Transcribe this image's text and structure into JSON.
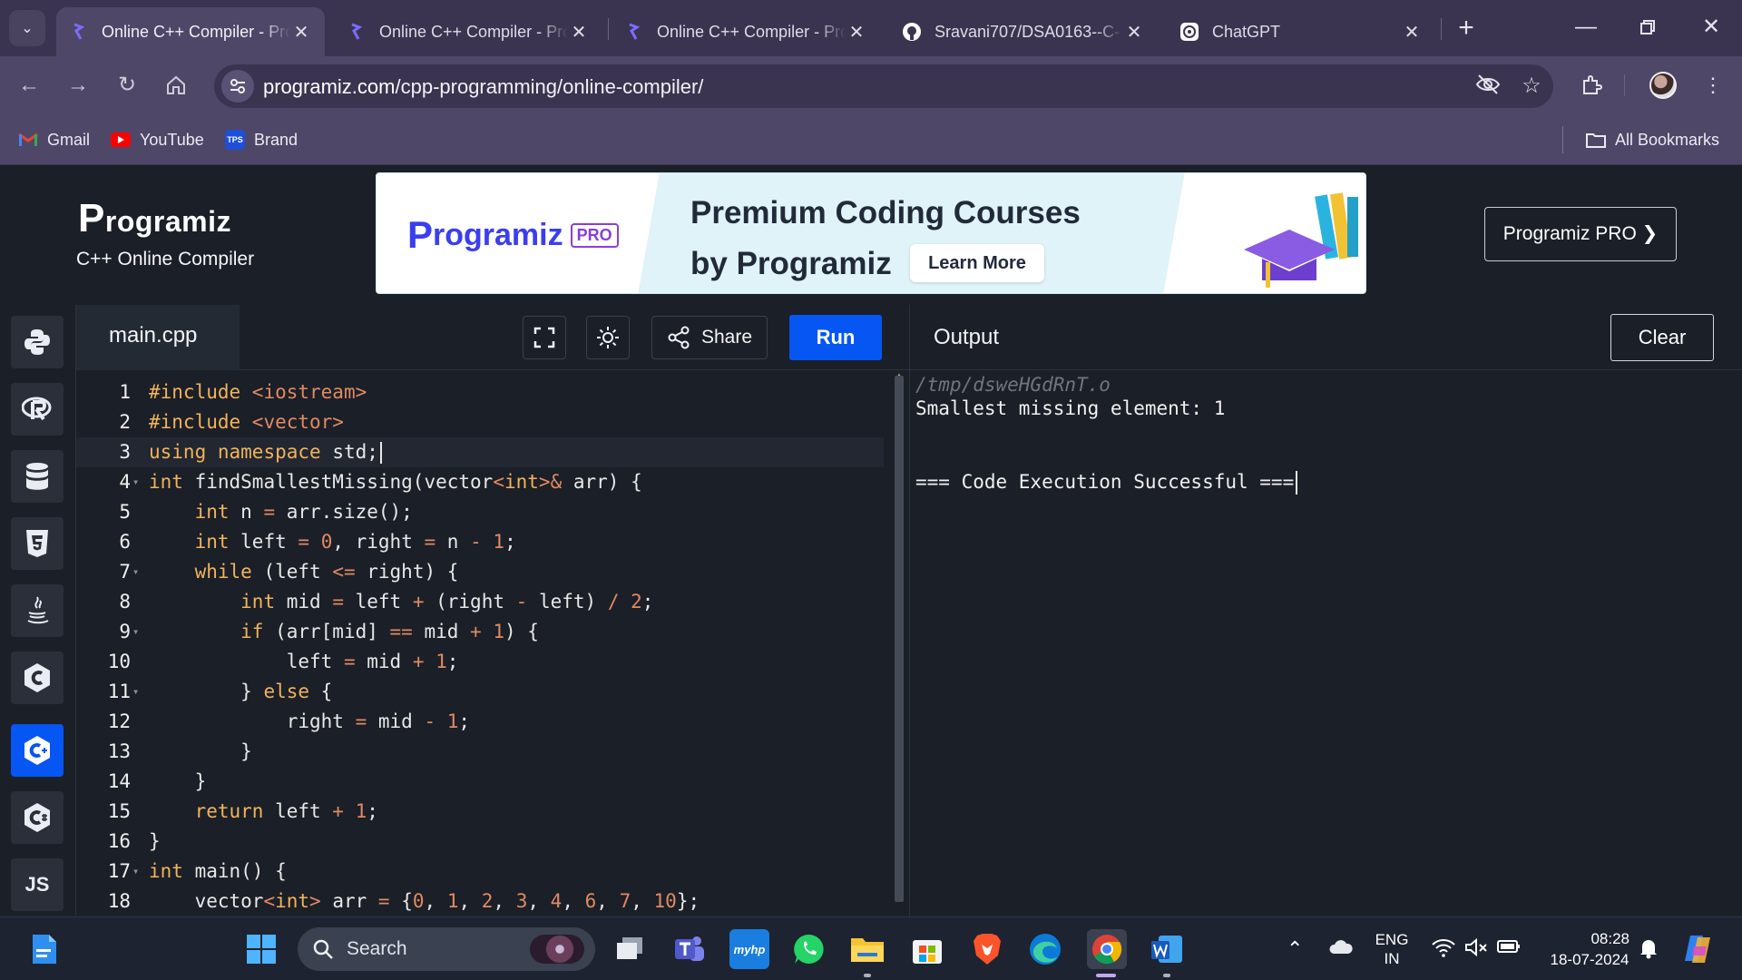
{
  "browser": {
    "tabs": [
      {
        "title": "Online C++ Compiler - Programiz",
        "active": true
      },
      {
        "title": "Online C++ Compiler - Programiz",
        "active": false
      },
      {
        "title": "Online C++ Compiler - Programiz",
        "active": false
      },
      {
        "title": "Sravani707/DSA0163--C-",
        "active": false
      },
      {
        "title": "ChatGPT",
        "active": false
      }
    ],
    "url_host": "programiz.com",
    "url_path": "/cpp-programming/online-compiler/",
    "bookmarks": [
      {
        "label": "Gmail",
        "icon": "gmail-icon"
      },
      {
        "label": "YouTube",
        "icon": "youtube-icon"
      },
      {
        "label": "Brand",
        "icon": "tps-icon",
        "icon_text": "TPS"
      }
    ],
    "all_bookmarks": "All Bookmarks"
  },
  "header": {
    "logo_first": "P",
    "logo_rest": "rogramiz",
    "subtitle": "C++ Online Compiler",
    "banner": {
      "logo_first": "P",
      "logo_rest": "rogramiz",
      "logo_badge": "PRO",
      "line1": "Premium Coding Courses",
      "line2": "by Programiz",
      "cta": "Learn More"
    },
    "pro_button": "Programiz PRO ❯"
  },
  "sidebar": {
    "languages": [
      {
        "name": "python",
        "icon": "python-icon"
      },
      {
        "name": "r",
        "icon": "r-icon"
      },
      {
        "name": "sql",
        "icon": "database-icon"
      },
      {
        "name": "html",
        "icon": "html5-icon",
        "glyph": "5"
      },
      {
        "name": "java",
        "icon": "java-icon"
      },
      {
        "name": "c",
        "icon": "c-icon",
        "glyph": "C"
      },
      {
        "name": "cpp",
        "icon": "cpp-icon",
        "glyph": "C",
        "active": true
      },
      {
        "name": "csharp",
        "icon": "csharp-icon",
        "glyph": "C"
      },
      {
        "name": "javascript",
        "icon": "js-icon",
        "glyph": "JS"
      }
    ]
  },
  "editor": {
    "filename": "main.cpp",
    "share_label": "Share",
    "run_label": "Run",
    "lines": [
      "#include <iostream>",
      "#include <vector>",
      "using namespace std;",
      "int findSmallestMissing(vector<int>& arr) {",
      "    int n = arr.size();",
      "    int left = 0, right = n - 1;",
      "    while (left <= right) {",
      "        int mid = left + (right - left) / 2;",
      "        if (arr[mid] == mid + 1) {",
      "            left = mid + 1;",
      "        } else {",
      "            right = mid - 1;",
      "        }",
      "    }",
      "    return left + 1;",
      "}",
      "int main() {",
      "    vector<int> arr = {0, 1, 2, 3, 4, 6, 7, 10};"
    ]
  },
  "output": {
    "title": "Output",
    "clear_label": "Clear",
    "path": "/tmp/dsweHGdRnT.o",
    "result": "Smallest missing element: 1",
    "status": "=== Code Execution Successful ==="
  },
  "taskbar": {
    "search_placeholder": "Search",
    "lang_line1": "ENG",
    "lang_line2": "IN",
    "time": "08:28",
    "date": "18-07-2024"
  }
}
